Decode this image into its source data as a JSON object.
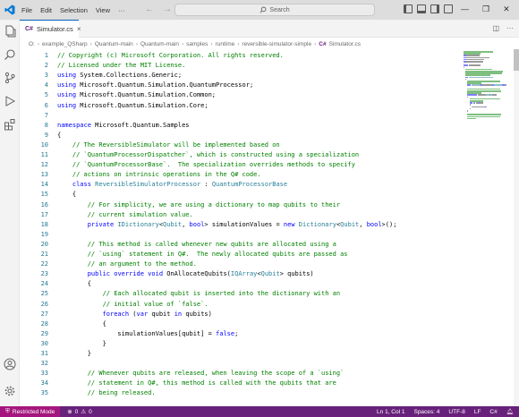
{
  "titlebar": {
    "menu": [
      "File",
      "Edit",
      "Selection",
      "View",
      "···"
    ],
    "search_placeholder": "Search"
  },
  "tab": {
    "label": "Simulator.cs",
    "close": "×"
  },
  "breadcrumb": [
    "O:",
    "example_QSharp",
    "Quantum-main",
    "Quantum-main",
    "samples",
    "runtime",
    "reversible-simulator-simple",
    "Simulator.cs"
  ],
  "editor": {
    "lines": [
      {
        "n": "1",
        "t": [
          [
            "// Copyright (c) Microsoft Corporation. All rights reserved.",
            "comment"
          ]
        ]
      },
      {
        "n": "2",
        "t": [
          [
            "// Licensed under the MIT License.",
            "comment"
          ]
        ]
      },
      {
        "n": "3",
        "t": [
          [
            "using",
            "kw"
          ],
          [
            " System.Collections.Generic;",
            ""
          ]
        ]
      },
      {
        "n": "4",
        "t": [
          [
            "using",
            "kw"
          ],
          [
            " Microsoft.Quantum.Simulation.QuantumProcessor;",
            ""
          ]
        ]
      },
      {
        "n": "5",
        "t": [
          [
            "using",
            "kw"
          ],
          [
            " Microsoft.Quantum.Simulation.Common;",
            ""
          ]
        ]
      },
      {
        "n": "6",
        "t": [
          [
            "using",
            "kw"
          ],
          [
            " Microsoft.Quantum.Simulation.Core;",
            ""
          ]
        ]
      },
      {
        "n": "7",
        "t": []
      },
      {
        "n": "8",
        "t": [
          [
            "namespace",
            "kw"
          ],
          [
            " Microsoft.Quantum.Samples",
            ""
          ]
        ]
      },
      {
        "n": "9",
        "t": [
          [
            "{",
            ""
          ]
        ]
      },
      {
        "n": "10",
        "t": [
          [
            "    // The ReversibleSimulator will be implemented based on",
            "comment"
          ]
        ]
      },
      {
        "n": "11",
        "t": [
          [
            "    // `QuantumProcessorDispatcher`, which is constructed using a specialization",
            "comment"
          ]
        ]
      },
      {
        "n": "12",
        "t": [
          [
            "    // `QuantumProcessorBase`.  The specialization overrides methods to specify",
            "comment"
          ]
        ]
      },
      {
        "n": "13",
        "t": [
          [
            "    // actions on intrinsic operations in the Q# code.",
            "comment"
          ]
        ]
      },
      {
        "n": "14",
        "t": [
          [
            "    ",
            ""
          ],
          [
            "class",
            "kw"
          ],
          [
            " ",
            ""
          ],
          [
            "ReversibleSimulatorProcessor",
            "type"
          ],
          [
            " : ",
            ""
          ],
          [
            "QuantumProcessorBase",
            "type"
          ]
        ]
      },
      {
        "n": "15",
        "t": [
          [
            "    {",
            ""
          ]
        ]
      },
      {
        "n": "16",
        "t": [
          [
            "        // For simplicity, we are using a dictionary to map qubits to their",
            "comment"
          ]
        ]
      },
      {
        "n": "17",
        "t": [
          [
            "        // current simulation value.",
            "comment"
          ]
        ]
      },
      {
        "n": "18",
        "t": [
          [
            "        ",
            ""
          ],
          [
            "private",
            "kw"
          ],
          [
            " ",
            ""
          ],
          [
            "IDictionary",
            "type"
          ],
          [
            "<",
            ""
          ],
          [
            "Qubit",
            "type"
          ],
          [
            ", ",
            ""
          ],
          [
            "bool",
            "kw"
          ],
          [
            "> simulationValues = ",
            ""
          ],
          [
            "new",
            "kw"
          ],
          [
            " ",
            ""
          ],
          [
            "Dictionary",
            "type"
          ],
          [
            "<",
            ""
          ],
          [
            "Qubit",
            "type"
          ],
          [
            ", ",
            ""
          ],
          [
            "bool",
            "kw"
          ],
          [
            ">();",
            ""
          ]
        ]
      },
      {
        "n": "19",
        "t": []
      },
      {
        "n": "20",
        "t": [
          [
            "        // This method is called whenever new qubits are allocated using a",
            "comment"
          ]
        ]
      },
      {
        "n": "21",
        "t": [
          [
            "        // `using` statement in Q#.  The newly allocated qubits are passed as",
            "comment"
          ]
        ]
      },
      {
        "n": "22",
        "t": [
          [
            "        // an argument to the method.",
            "comment"
          ]
        ]
      },
      {
        "n": "23",
        "t": [
          [
            "        ",
            ""
          ],
          [
            "public",
            "kw"
          ],
          [
            " ",
            ""
          ],
          [
            "override",
            "kw"
          ],
          [
            " ",
            ""
          ],
          [
            "void",
            "kw"
          ],
          [
            " OnAllocateQubits(",
            ""
          ],
          [
            "IQArray",
            "type"
          ],
          [
            "<",
            ""
          ],
          [
            "Qubit",
            "type"
          ],
          [
            "> qubits)",
            ""
          ]
        ]
      },
      {
        "n": "24",
        "t": [
          [
            "        {",
            ""
          ]
        ]
      },
      {
        "n": "25",
        "t": [
          [
            "            // Each allocated qubit is inserted into the dictionary with an",
            "comment"
          ]
        ]
      },
      {
        "n": "26",
        "t": [
          [
            "            // initial value of `false`.",
            "comment"
          ]
        ]
      },
      {
        "n": "27",
        "t": [
          [
            "            ",
            ""
          ],
          [
            "foreach",
            "kw"
          ],
          [
            " (",
            ""
          ],
          [
            "var",
            "kw"
          ],
          [
            " qubit ",
            ""
          ],
          [
            "in",
            "kw"
          ],
          [
            " qubits)",
            ""
          ]
        ]
      },
      {
        "n": "28",
        "t": [
          [
            "            {",
            ""
          ]
        ]
      },
      {
        "n": "29",
        "t": [
          [
            "                simulationValues[qubit] = ",
            ""
          ],
          [
            "false",
            "kw"
          ],
          [
            ";",
            ""
          ]
        ]
      },
      {
        "n": "30",
        "t": [
          [
            "            }",
            ""
          ]
        ]
      },
      {
        "n": "31",
        "t": [
          [
            "        }",
            ""
          ]
        ]
      },
      {
        "n": "32",
        "t": []
      },
      {
        "n": "33",
        "t": [
          [
            "        // Whenever qubits are released, when leaving the scope of a `using`",
            "comment"
          ]
        ]
      },
      {
        "n": "34",
        "t": [
          [
            "        // statement in Q#, this method is called with the qubits that are",
            "comment"
          ]
        ]
      },
      {
        "n": "35",
        "t": [
          [
            "        // being released.",
            "comment"
          ]
        ]
      }
    ]
  },
  "statusbar": {
    "restricted": "Restricted Mode",
    "errors": "0",
    "warnings": "0",
    "position": "Ln 1, Col 1",
    "spaces": "Spaces: 4",
    "encoding": "UTF-8",
    "eol": "LF",
    "language": "C#"
  },
  "colors": {
    "comment": "#008000",
    "keyword": "#0000ff",
    "type": "#267f99",
    "line_number": "#237893",
    "statusbar": "#68217a",
    "restricted": "#a4167d"
  }
}
